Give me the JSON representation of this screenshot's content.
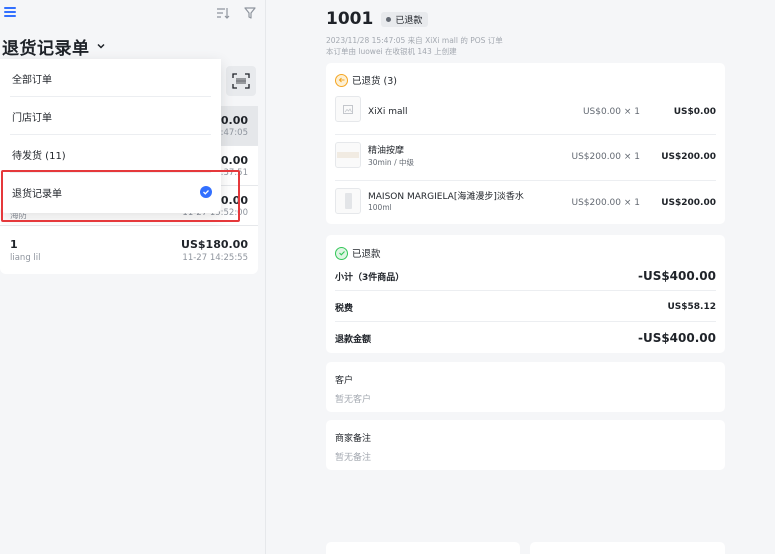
{
  "left": {
    "title": "退货记录单",
    "dropdown": [
      {
        "label": "全部订单",
        "selected": false
      },
      {
        "label": "门店订单",
        "selected": false
      },
      {
        "label": "待发货 (11)",
        "selected": false
      },
      {
        "label": "退货记录单",
        "selected": true
      }
    ],
    "orders": [
      {
        "amount_partial": "00.00",
        "time_partial": "5:47:05"
      },
      {
        "amount_partial": "00.00",
        "time_partial": "5:37:51"
      },
      {
        "no_partial": "海防",
        "amount_partial": "70.00",
        "time_partial": "11-27 15:52:00"
      },
      {
        "no": "1",
        "name": "liang lil",
        "amount": "US$180.00",
        "time": "11-27 14:25:55"
      }
    ]
  },
  "detail": {
    "order_no": "1001",
    "status": "已退款",
    "meta_line1": "2023/11/28 15:47:05 来自 XiXi mall 的 POS 订单",
    "meta_line2": "本订单由  luowei  在收银机  143  上创建",
    "returned_header": "已退货 (3)",
    "items": [
      {
        "name": "XiXi mall",
        "sub": "",
        "price": "US$0.00 × 1",
        "total": "US$0.00"
      },
      {
        "name": "精油按摩",
        "sub": "30min / 中级",
        "price": "US$200.00 × 1",
        "total": "US$200.00"
      },
      {
        "name": "MAISON MARGIELA[海滩漫步]淡香水",
        "sub": "100ml",
        "price": "US$200.00 × 1",
        "total": "US$200.00"
      }
    ],
    "refund_header": "已退款",
    "subtotal_label": "小计（3件商品）",
    "subtotal_value": "-US$400.00",
    "tax_label": "税费",
    "tax_value": "US$58.12",
    "refund_label": "退款金额",
    "refund_value": "-US$400.00",
    "customer_label": "客户",
    "customer_value": "暂无客户",
    "note_label": "商家备注",
    "note_value": "暂无备注"
  },
  "colors": {
    "accent": "#3370ff",
    "highlight": "#e5383b",
    "returned_icon": "#f5a623",
    "refunded_icon": "#34c759"
  }
}
